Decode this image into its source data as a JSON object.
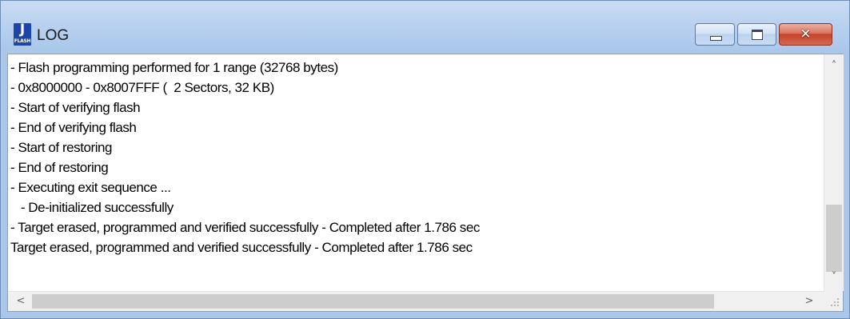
{
  "window": {
    "title": "LOG",
    "icon": {
      "name": "jflash-app-icon",
      "letter": "J",
      "sublabel": "FLASH",
      "color": "#1d45a8"
    },
    "controls": {
      "minimize_glyph": "minimize-icon",
      "maximize_glyph": "maximize-icon",
      "close_glyph": "✕"
    }
  },
  "log": {
    "lines": [
      "- Flash programming performed for 1 range (32768 bytes)",
      "- 0x8000000 - 0x8007FFF (  2 Sectors, 32 KB)",
      "- Start of verifying flash",
      "- End of verifying flash",
      "- Start of restoring",
      "- End of restoring",
      "- Executing exit sequence ...",
      "   - De-initialized successfully",
      "- Target erased, programmed and verified successfully - Completed after 1.786 sec",
      "Target erased, programmed and verified successfully - Completed after 1.786 sec"
    ]
  },
  "scrollbars": {
    "up_arrow": "˄",
    "down_arrow": "˅",
    "left_arrow": "<",
    "right_arrow": ">",
    "vertical_position": 0.87,
    "horizontal_position": 0.0
  }
}
